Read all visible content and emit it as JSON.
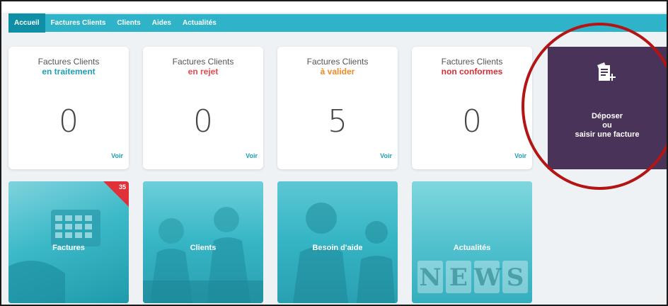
{
  "nav": {
    "items": [
      {
        "label": "Accueil",
        "active": true
      },
      {
        "label": "Factures Clients",
        "active": false
      },
      {
        "label": "Clients",
        "active": false
      },
      {
        "label": "Aides",
        "active": false
      },
      {
        "label": "Actualités",
        "active": false
      }
    ]
  },
  "cards": [
    {
      "title": "Factures Clients",
      "status": "en traitement",
      "status_color": "#1e9fb8",
      "count": "0",
      "link": "Voir"
    },
    {
      "title": "Factures Clients",
      "status": "en rejet",
      "status_color": "#e8484f",
      "count": "0",
      "link": "Voir"
    },
    {
      "title": "Factures Clients",
      "status": "à valider",
      "status_color": "#f08a24",
      "count": "5",
      "link": "Voir"
    },
    {
      "title": "Factures Clients",
      "status": "non conformes",
      "status_color": "#d92b35",
      "count": "0",
      "link": "Voir"
    }
  ],
  "deposit": {
    "line1": "Déposer",
    "line2": "ou",
    "line3": "saisir une facture",
    "icon": "add-document-icon",
    "color": "#4a3358"
  },
  "tiles": [
    {
      "label": "Factures",
      "badge": "35",
      "icon": "calculator-image"
    },
    {
      "label": "Clients",
      "icon": "handshake-image"
    },
    {
      "label": "Besoin d'aide",
      "icon": "support-team-image"
    },
    {
      "label": "Actualités",
      "icon": "news-image",
      "letters": [
        "N",
        "E",
        "W",
        "S"
      ]
    }
  ],
  "colors": {
    "accent": "#2fb3c8",
    "nav_active": "#0e8fa6",
    "annotation": "#b41414"
  }
}
